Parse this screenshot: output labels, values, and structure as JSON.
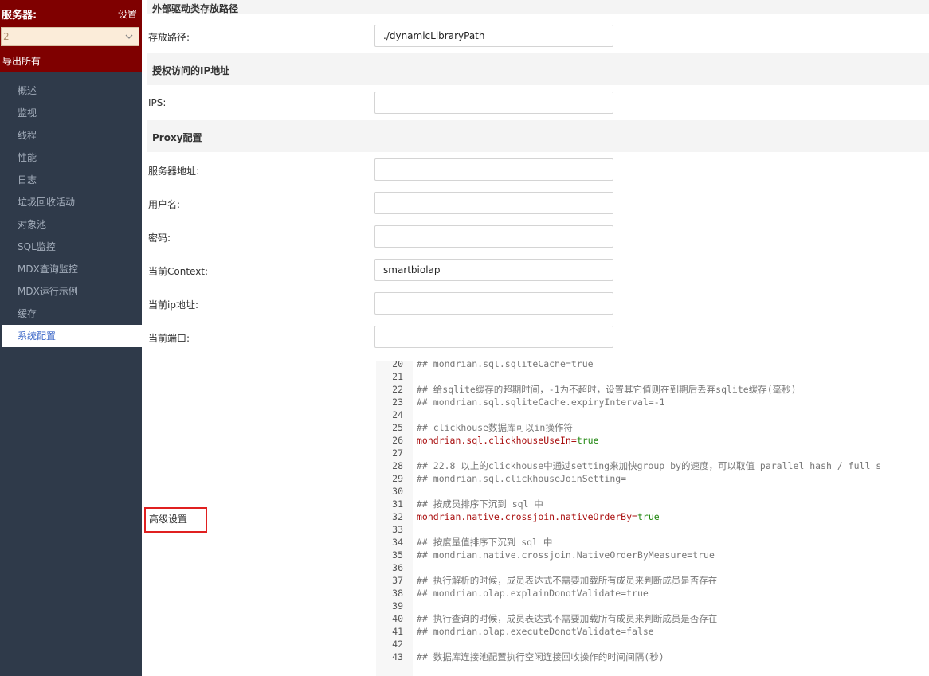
{
  "sidebar": {
    "server_label": "服务器:",
    "settings_label": "设置",
    "server_select_value": "2",
    "export_all_label": "导出所有",
    "nav_items": [
      "概述",
      "监视",
      "线程",
      "性能",
      "日志",
      "垃圾回收活动",
      "对象池",
      "SQL监控",
      "MDX查询监控",
      "MDX运行示例",
      "缓存",
      "系统配置"
    ],
    "active_item": "系统配置"
  },
  "main": {
    "top_section_title": "外部驱动类存放路径",
    "storage_path_label": "存放路径:",
    "storage_path_value": "./dynamicLibraryPath",
    "ip_section_title": "授权访问的IP地址",
    "ips_label": "IPS:",
    "ips_value": "",
    "proxy_section_title": "Proxy配置",
    "server_address_label": "服务器地址:",
    "server_address_value": "",
    "username_label": "用户名:",
    "username_value": "",
    "password_label": "密码:",
    "password_value": "",
    "context_label": "当前Context:",
    "context_value": "smartbiolap",
    "current_ip_label": "当前ip地址:",
    "current_ip_value": "",
    "current_port_label": "当前端口:",
    "current_port_value": "",
    "advanced_settings_label": "高级设置"
  },
  "editor": {
    "lines": [
      {
        "n": "20",
        "text": "## mondrian.sql.sqliteCache=true",
        "kind": "comment"
      },
      {
        "n": "21",
        "text": "",
        "kind": "comment"
      },
      {
        "n": "22",
        "text": "## 给sqlite缓存的超期时间，-1为不超时，设置其它值则在到期后丢弃sqlite缓存(毫秒)",
        "kind": "comment"
      },
      {
        "n": "23",
        "text": "## mondrian.sql.sqliteCache.expiryInterval=-1",
        "kind": "comment"
      },
      {
        "n": "24",
        "text": "",
        "kind": "comment"
      },
      {
        "n": "25",
        "text": "## clickhouse数据库可以in操作符",
        "kind": "comment"
      },
      {
        "n": "26",
        "key": "mondrian.sql.clickhouseUseIn",
        "value": "true",
        "kind": "prop"
      },
      {
        "n": "27",
        "text": "",
        "kind": "comment"
      },
      {
        "n": "28",
        "text": "## 22.8 以上的clickhouse中通过setting来加快group by的速度，可以取值 parallel_hash / full_s",
        "kind": "comment"
      },
      {
        "n": "29",
        "text": "## mondrian.sql.clickhouseJoinSetting=",
        "kind": "comment"
      },
      {
        "n": "30",
        "text": "",
        "kind": "comment"
      },
      {
        "n": "31",
        "text": "## 按成员排序下沉到 sql 中",
        "kind": "comment"
      },
      {
        "n": "32",
        "key": "mondrian.native.crossjoin.nativeOrderBy",
        "value": "true",
        "kind": "prop"
      },
      {
        "n": "33",
        "text": "",
        "kind": "comment"
      },
      {
        "n": "34",
        "text": "## 按度量值排序下沉到 sql 中",
        "kind": "comment"
      },
      {
        "n": "35",
        "text": "## mondrian.native.crossjoin.NativeOrderByMeasure=true",
        "kind": "comment"
      },
      {
        "n": "36",
        "text": "",
        "kind": "comment"
      },
      {
        "n": "37",
        "text": "## 执行解析的时候，成员表达式不需要加载所有成员来判断成员是否存在",
        "kind": "comment"
      },
      {
        "n": "38",
        "text": "## mondrian.olap.explainDonotValidate=true",
        "kind": "comment"
      },
      {
        "n": "39",
        "text": "",
        "kind": "comment"
      },
      {
        "n": "40",
        "text": "## 执行查询的时候，成员表达式不需要加载所有成员来判断成员是否存在",
        "kind": "comment"
      },
      {
        "n": "41",
        "text": "## mondrian.olap.executeDonotValidate=false",
        "kind": "comment"
      },
      {
        "n": "42",
        "text": "",
        "kind": "comment"
      },
      {
        "n": "43",
        "text": "## 数据库连接池配置执行空闲连接回收操作的时间间隔(秒)",
        "kind": "comment"
      }
    ]
  },
  "colors": {
    "sidebar_bg": "#2f3a4a",
    "server_header_bg": "#7f0000",
    "active_nav_text": "#3a66c7",
    "code_property": "#aa1111",
    "code_value": "#228811",
    "highlight_border": "#e02020"
  }
}
